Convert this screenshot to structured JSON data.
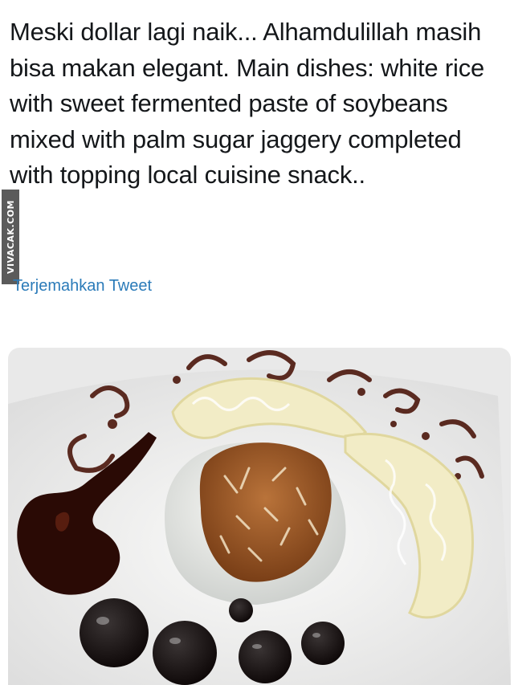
{
  "tweet": {
    "text": "Meski dollar lagi naik... Alhamdulillah masih bisa makan elegant. Main dishes: white rice with sweet fermented paste of soybeans mixed with palm sugar jaggery completed with topping local cuisine snack..",
    "translate_label": "Terjemahkan Tweet"
  },
  "watermark": {
    "text": "VIVACAK.COM"
  },
  "photo": {
    "subject": "plated white rice with fermented soybean topping, krupuk crackers and sauce dots"
  },
  "colors": {
    "text": "#14171a",
    "link": "#2b7bb9",
    "plate": "#f4f4f2",
    "sauce": "#2a0a05"
  }
}
